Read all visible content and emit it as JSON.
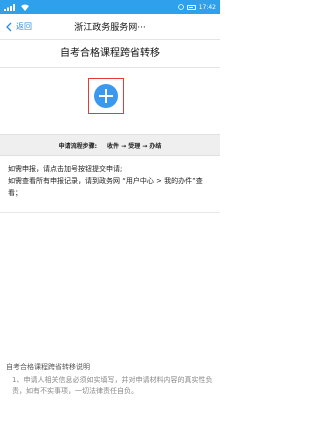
{
  "status_bar": {
    "carrier_icon": "signal-icon",
    "time": "17:42"
  },
  "nav": {
    "back_label": "返回",
    "title": "浙江政务服务网···"
  },
  "page": {
    "heading": "自考合格课程跨省转移"
  },
  "add_button": {
    "icon": "plus-circle-icon",
    "color": "#3a98ef",
    "highlight_color": "#e23b3b"
  },
  "process": {
    "label": "申请流程步骤:",
    "steps": "收件 → 受理 → 办结"
  },
  "notice": {
    "line1": "如需申报，请点击加号按钮提交申请;",
    "line2": "如需查看所有申报记录，请到政务网 “用户中心 > 我的办件”查看；"
  },
  "footer": {
    "title": "自考合格课程跨省转移说明",
    "text": "1、申请人相关信息必须如实填写，并对申请材料内容的真实性负责，如有不实事项，一切法律责任自负。"
  }
}
